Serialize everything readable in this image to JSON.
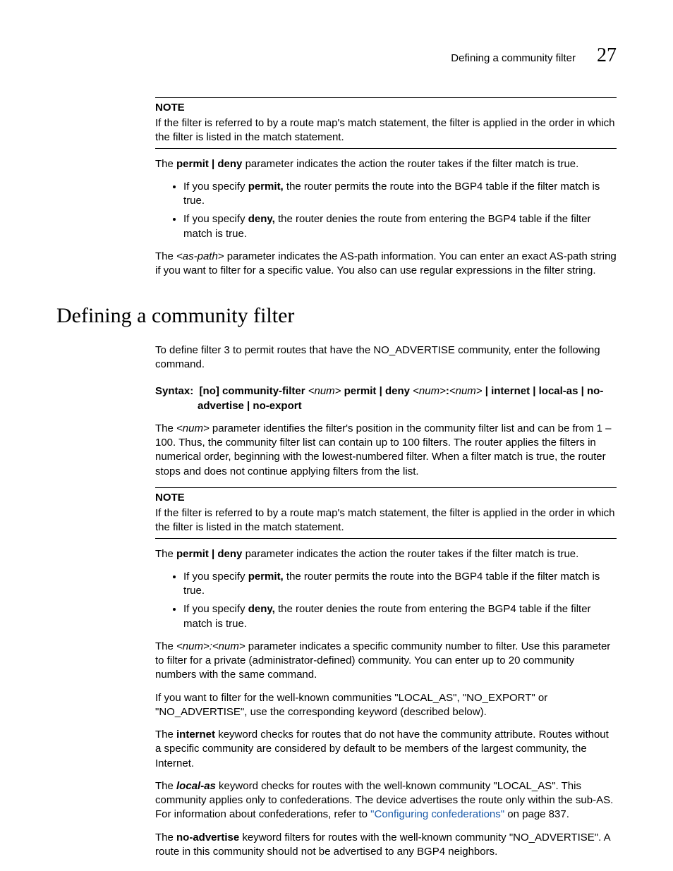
{
  "header": {
    "running_title": "Defining a community filter",
    "chapter_number": "27"
  },
  "note1": {
    "label": "NOTE",
    "text": "If the filter is referred to by a route map's match statement, the filter is applied in the order in which the filter is listed in the match statement."
  },
  "p_permit_deny_intro_1_a": "The ",
  "p_permit_deny_intro_1_b": "permit | deny",
  "p_permit_deny_intro_1_c": " parameter indicates the action the router takes if the filter match is true.",
  "bullets1": {
    "b1_a": "If you specify ",
    "b1_b": "permit,",
    "b1_c": " the router permits the route into the BGP4 table if the filter match is true.",
    "b2_a": "If you specify ",
    "b2_b": "deny,",
    "b2_c": " the router denies the route from entering the BGP4 table if the filter match is true."
  },
  "p_aspath_a": "The ",
  "p_aspath_b": "<as-path>",
  "p_aspath_c": " parameter indicates the AS-path information.  You can enter an exact AS-path string if you want to filter for a specific value.  You also can use regular expressions in the filter string.",
  "section_title": "Defining a community filter",
  "p_intro": "To define filter 3 to permit routes that have the NO_ADVERTISE community, enter the following command.",
  "syntax": {
    "label": "Syntax:",
    "no": "[no]",
    "cmd": " community-filter ",
    "num1": "<num>",
    "pd": " permit | deny ",
    "num2": "<num>",
    "colon": ":",
    "num3": "<num>",
    "tail": " | internet | local-as | no-advertise | no-export"
  },
  "p_num_a": "The ",
  "p_num_b": "<num>",
  "p_num_c": " parameter identifies the filter's position in the community filter list and can be from 1 – 100.  Thus, the community filter list can contain up to 100 filters.  The router applies the filters in numerical order, beginning with the lowest-numbered filter.  When a filter match is true, the router stops and does not continue applying filters from the list.",
  "note2": {
    "label": "NOTE",
    "text": "If the filter is referred to by a route map's match statement, the filter is applied in the order in which the filter is listed in the match statement."
  },
  "p_permit_deny_intro_2_a": "The ",
  "p_permit_deny_intro_2_b": "permit | deny",
  "p_permit_deny_intro_2_c": " parameter indicates the action the router takes if the filter match is true.",
  "bullets2": {
    "b1_a": "If you specify ",
    "b1_b": "permit,",
    "b1_c": " the router permits the route into the BGP4 table if the filter match is true.",
    "b2_a": "If you specify ",
    "b2_b": "deny,",
    "b2_c": " the router denies the route from entering the BGP4 table if the filter match is true."
  },
  "p_numnum_a": "The ",
  "p_numnum_b": "<num>:<num>",
  "p_numnum_c": " parameter indicates a specific community number to filter.  Use this parameter to filter for a private (administrator-defined) community.  You can enter up to 20 community numbers with the same command.",
  "p_wellknown": "If you want to filter for the well-known communities \"LOCAL_AS\", \"NO_EXPORT\" or \"NO_ADVERTISE\", use the corresponding keyword (described below).",
  "p_internet_a": "The ",
  "p_internet_b": "internet",
  "p_internet_c": " keyword checks for routes that do not have the community attribute.  Routes without a specific community are considered by default to be members of the largest community, the Internet.",
  "p_localas_a": "The ",
  "p_localas_b": "local-as",
  "p_localas_c": " keyword checks for routes with the well-known community \"LOCAL_AS\". This community applies only to confederations. The device advertises the route only within the sub-AS. For information about confederations, refer to ",
  "p_localas_link": "\"Configuring confederations\"",
  "p_localas_d": " on page 837.",
  "p_noadv_a": "The ",
  "p_noadv_b": "no-advertise",
  "p_noadv_c": " keyword filters for routes with the well-known community \"NO_ADVERTISE\".  A route in this community should not be advertised to any BGP4 neighbors."
}
